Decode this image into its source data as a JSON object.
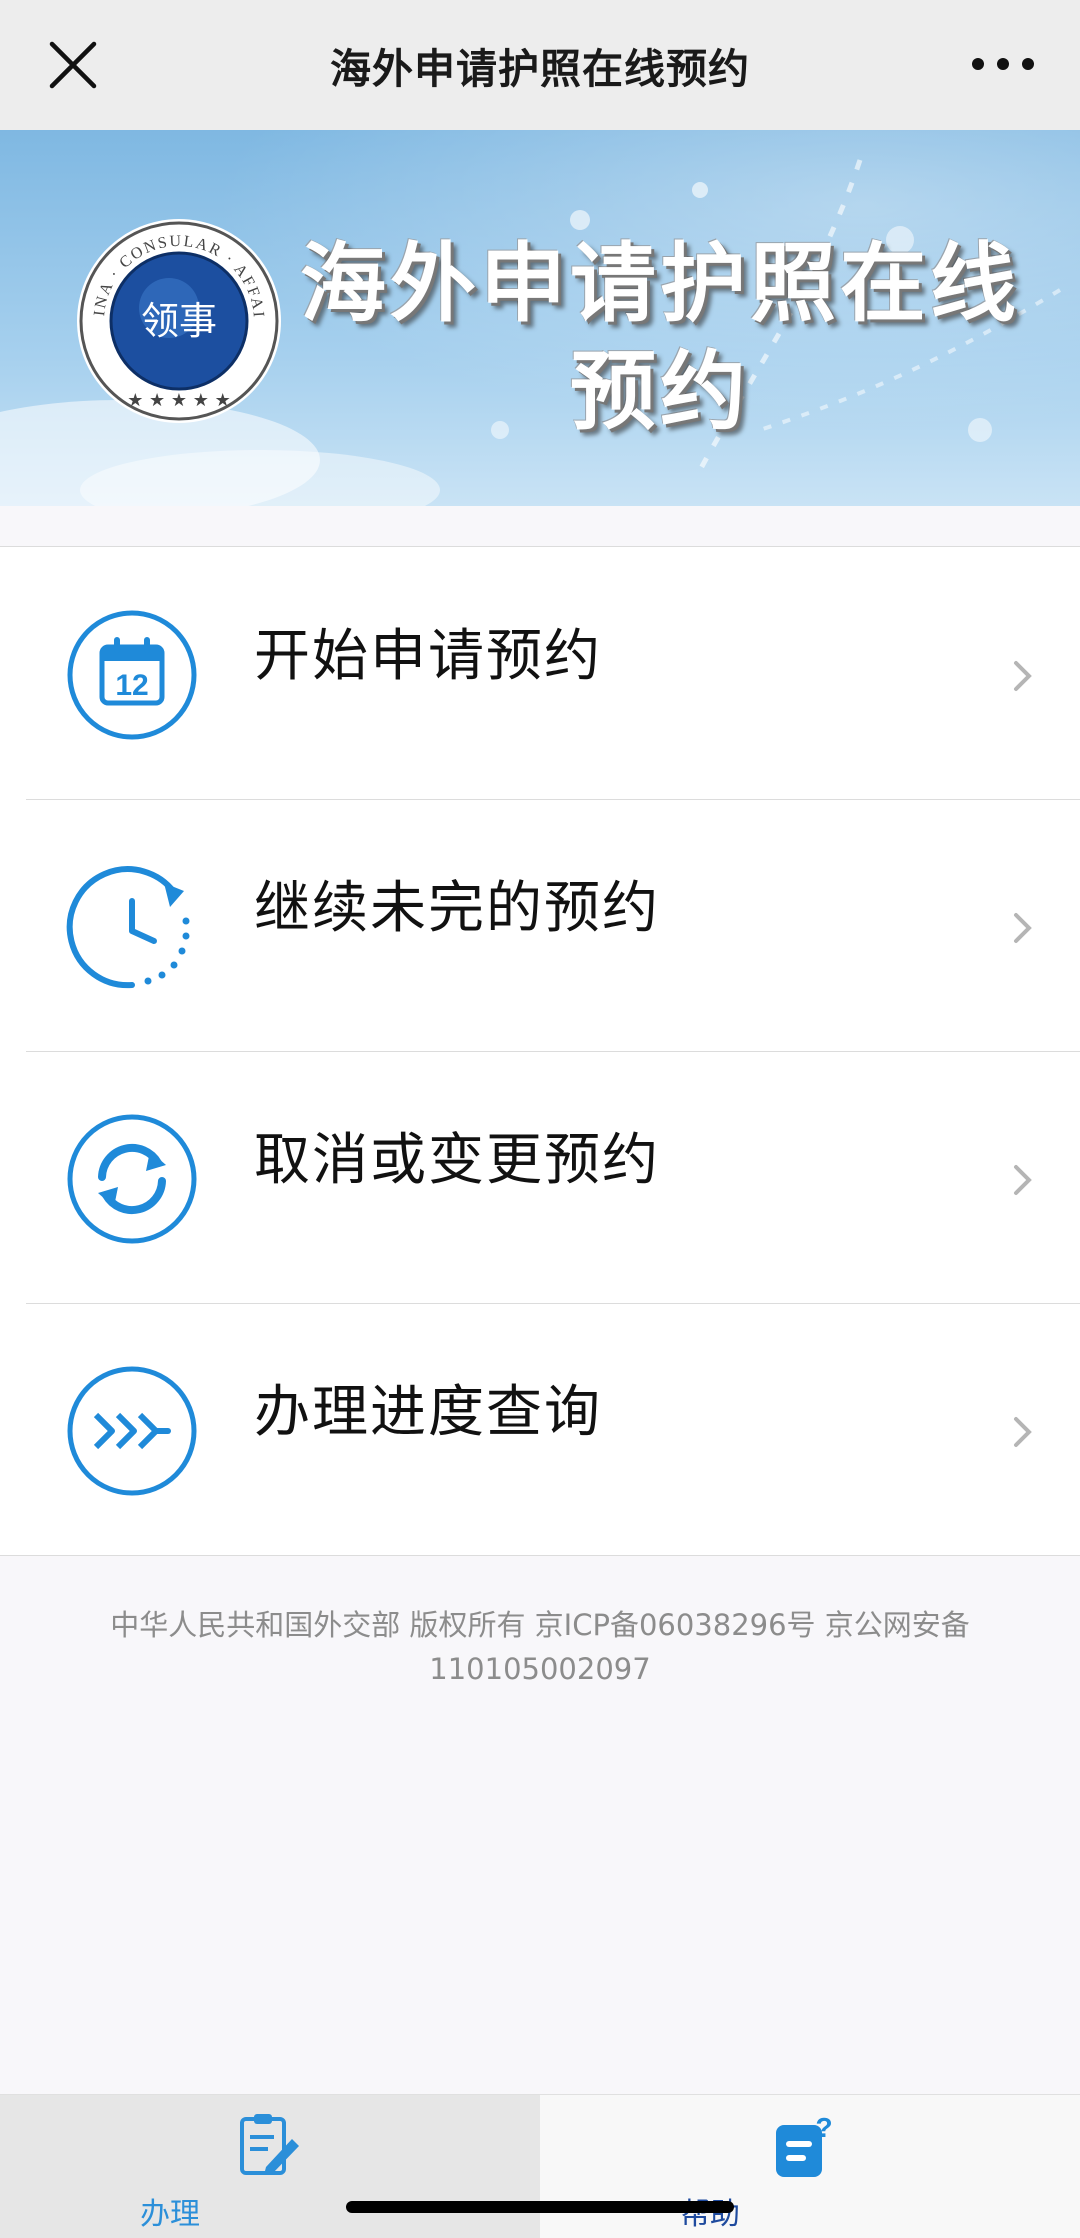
{
  "header": {
    "title": "海外申请护照在线预约",
    "close_icon": "close-icon",
    "more_icon": "more-dots-icon"
  },
  "banner": {
    "title_line1": "海外申请护照在线",
    "title_line2": "预约",
    "emblem_text": "CHINA · CONSULAR · AFFAIRS",
    "emblem_glyph": "领事"
  },
  "menu": {
    "items": [
      {
        "label": "开始申请预约",
        "icon": "calendar-icon",
        "calendar_day": "12"
      },
      {
        "label": "继续未完的预约",
        "icon": "clock-icon"
      },
      {
        "label": "取消或变更预约",
        "icon": "refresh-icon"
      },
      {
        "label": "办理进度查询",
        "icon": "progress-arrows-icon"
      }
    ]
  },
  "footer": {
    "line1": "中华人民共和国外交部 版权所有 京ICP备06038296号 京公网安备",
    "line2": "110105002097"
  },
  "tabbar": {
    "tabs": [
      {
        "label": "办理",
        "icon": "edit-document-icon"
      },
      {
        "label": "帮助",
        "icon": "help-document-icon"
      }
    ]
  },
  "colors": {
    "accent_blue": "#1f8ad9",
    "banner_sky": "#8fc3e6",
    "active_tab_text": "#2b8fd9",
    "help_tab_text": "#1e4a9e",
    "footer_text": "#8c8c8c"
  }
}
